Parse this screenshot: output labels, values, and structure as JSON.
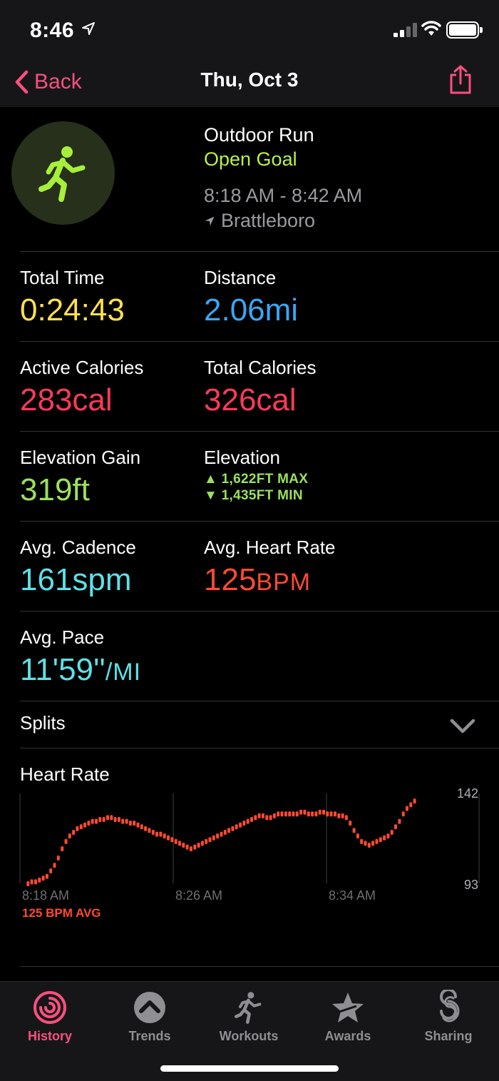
{
  "status": {
    "time": "8:46"
  },
  "nav": {
    "back_label": "Back",
    "title": "Thu, Oct 3"
  },
  "workout": {
    "type": "Outdoor Run",
    "goal": "Open Goal",
    "time_range": "8:18 AM - 8:42 AM",
    "location": "Brattleboro"
  },
  "metrics": {
    "total_time": {
      "label": "Total Time",
      "value": "0:24:43"
    },
    "distance": {
      "label": "Distance",
      "value": "2.06mi"
    },
    "active_calories": {
      "label": "Active Calories",
      "value": "283cal"
    },
    "total_calories": {
      "label": "Total Calories",
      "value": "326cal"
    },
    "elevation_gain": {
      "label": "Elevation Gain",
      "value": "319ft"
    },
    "elevation": {
      "label": "Elevation",
      "max": "▲ 1,622FT MAX",
      "min": "▼ 1,435FT MIN"
    },
    "avg_cadence": {
      "label": "Avg. Cadence",
      "value": "161spm"
    },
    "avg_heart_rate": {
      "label": "Avg. Heart Rate",
      "value": "125",
      "unit": "BPM"
    },
    "avg_pace": {
      "label": "Avg. Pace",
      "value": "11'59''",
      "unit": "/MI"
    }
  },
  "splits": {
    "label": "Splits"
  },
  "heart_rate": {
    "title": "Heart Rate",
    "avg_label": "125 BPM AVG",
    "chart_data": {
      "type": "scatter",
      "x_tick_labels": [
        "8:18 AM",
        "8:26 AM",
        "8:34 AM"
      ],
      "y_max_label": "142",
      "y_min_label": "93",
      "ylim": [
        93,
        142
      ],
      "x_minutes_range": [
        0,
        24
      ],
      "color": "#ff4a32",
      "points": [
        [
          0.2,
          93
        ],
        [
          0.4,
          94
        ],
        [
          0.6,
          94
        ],
        [
          0.8,
          95
        ],
        [
          1.0,
          96
        ],
        [
          1.2,
          97
        ],
        [
          1.4,
          100
        ],
        [
          1.6,
          103
        ],
        [
          1.8,
          107
        ],
        [
          2.0,
          112
        ],
        [
          2.2,
          116
        ],
        [
          2.4,
          119
        ],
        [
          2.6,
          121
        ],
        [
          2.8,
          123
        ],
        [
          3.0,
          124
        ],
        [
          3.2,
          125
        ],
        [
          3.4,
          126
        ],
        [
          3.6,
          127
        ],
        [
          3.8,
          127
        ],
        [
          4.0,
          128
        ],
        [
          4.2,
          128
        ],
        [
          4.4,
          129
        ],
        [
          4.6,
          129
        ],
        [
          4.8,
          128
        ],
        [
          5.0,
          128
        ],
        [
          5.2,
          127
        ],
        [
          5.4,
          127
        ],
        [
          5.6,
          126
        ],
        [
          5.8,
          126
        ],
        [
          6.0,
          125
        ],
        [
          6.2,
          124
        ],
        [
          6.4,
          123
        ],
        [
          6.6,
          122
        ],
        [
          6.8,
          121
        ],
        [
          7.0,
          120
        ],
        [
          7.2,
          120
        ],
        [
          7.4,
          119
        ],
        [
          7.6,
          118
        ],
        [
          7.8,
          117
        ],
        [
          8.0,
          116
        ],
        [
          8.2,
          115
        ],
        [
          8.4,
          114
        ],
        [
          8.6,
          113
        ],
        [
          8.8,
          112
        ],
        [
          9.0,
          113
        ],
        [
          9.2,
          114
        ],
        [
          9.4,
          115
        ],
        [
          9.6,
          116
        ],
        [
          9.8,
          117
        ],
        [
          10.0,
          118
        ],
        [
          10.2,
          119
        ],
        [
          10.4,
          120
        ],
        [
          10.6,
          121
        ],
        [
          10.8,
          122
        ],
        [
          11.0,
          123
        ],
        [
          11.2,
          124
        ],
        [
          11.4,
          125
        ],
        [
          11.6,
          126
        ],
        [
          11.8,
          127
        ],
        [
          12.0,
          128
        ],
        [
          12.2,
          129
        ],
        [
          12.4,
          130
        ],
        [
          12.6,
          130
        ],
        [
          12.8,
          129
        ],
        [
          13.0,
          129
        ],
        [
          13.2,
          130
        ],
        [
          13.4,
          131
        ],
        [
          13.6,
          131
        ],
        [
          13.8,
          131
        ],
        [
          14.0,
          131
        ],
        [
          14.2,
          131
        ],
        [
          14.4,
          131
        ],
        [
          14.6,
          132
        ],
        [
          14.8,
          132
        ],
        [
          15.0,
          131
        ],
        [
          15.2,
          131
        ],
        [
          15.4,
          131
        ],
        [
          15.6,
          132
        ],
        [
          15.8,
          132
        ],
        [
          16.0,
          131
        ],
        [
          16.2,
          131
        ],
        [
          16.4,
          131
        ],
        [
          16.6,
          130
        ],
        [
          16.8,
          130
        ],
        [
          17.0,
          129
        ],
        [
          17.2,
          126
        ],
        [
          17.4,
          122
        ],
        [
          17.6,
          119
        ],
        [
          17.8,
          116
        ],
        [
          18.0,
          115
        ],
        [
          18.2,
          114
        ],
        [
          18.4,
          115
        ],
        [
          18.6,
          116
        ],
        [
          18.8,
          117
        ],
        [
          19.0,
          118
        ],
        [
          19.2,
          119
        ],
        [
          19.4,
          121
        ],
        [
          19.6,
          124
        ],
        [
          19.8,
          127
        ],
        [
          20.0,
          131
        ],
        [
          20.2,
          134
        ],
        [
          20.4,
          136
        ],
        [
          20.6,
          138
        ]
      ]
    }
  },
  "tabs": [
    {
      "label": "History",
      "icon": "history-rings-icon",
      "active": true
    },
    {
      "label": "Trends",
      "icon": "trends-chevron-icon",
      "active": false
    },
    {
      "label": "Workouts",
      "icon": "runner-icon",
      "active": false
    },
    {
      "label": "Awards",
      "icon": "award-star-icon",
      "active": false
    },
    {
      "label": "Sharing",
      "icon": "sharing-icon",
      "active": false
    }
  ],
  "colors": {
    "accent": "#fa4f7f",
    "goal_green": "#b6f24c",
    "time_yellow": "#ffe14d",
    "distance_blue": "#39a7f5",
    "calories_red": "#ff3a58",
    "elevation_green": "#9be05f",
    "cadence_cyan": "#5ee0e6",
    "heart_orange": "#ff4a32"
  }
}
